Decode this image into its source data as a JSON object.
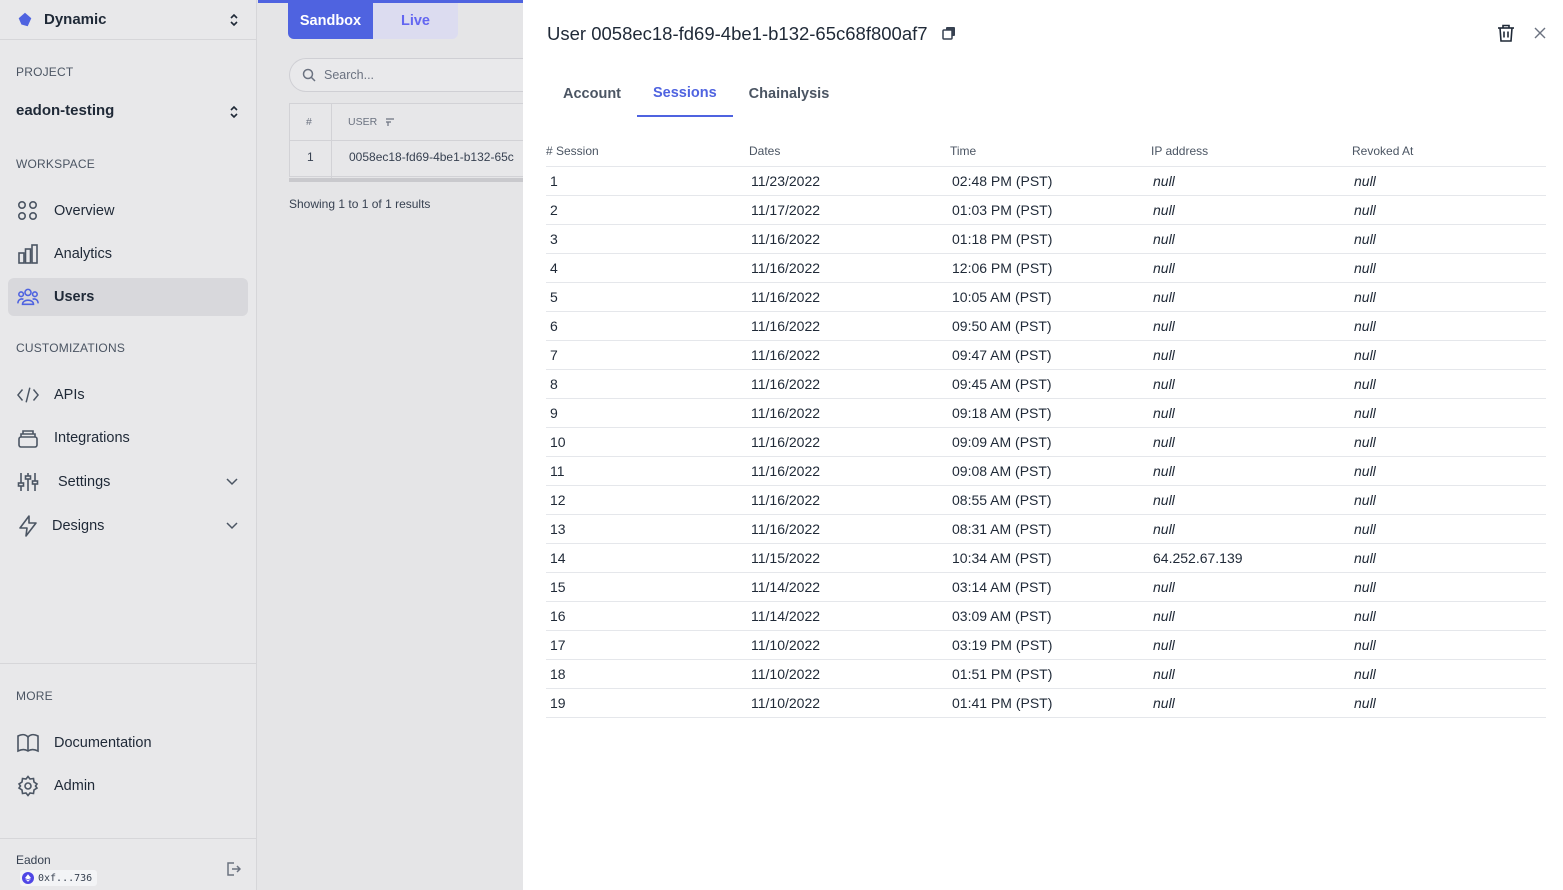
{
  "sidebar": {
    "org_name": "Dynamic",
    "project_label": "PROJECT",
    "project_name": "eadon-testing",
    "workspace_label": "WORKSPACE",
    "workspace_items": [
      {
        "label": "Overview",
        "icon": "grid-icon"
      },
      {
        "label": "Analytics",
        "icon": "bar-chart-icon"
      },
      {
        "label": "Users",
        "icon": "users-icon",
        "active": true
      }
    ],
    "customizations_label": "CUSTOMIZATIONS",
    "customization_items": [
      {
        "label": "APIs",
        "icon": "code-icon"
      },
      {
        "label": "Integrations",
        "icon": "layers-icon"
      },
      {
        "label": "Settings",
        "icon": "sliders-icon",
        "expandable": true
      },
      {
        "label": "Designs",
        "icon": "lightning-icon",
        "expandable": true
      }
    ],
    "more_label": "MORE",
    "more_items": [
      {
        "label": "Documentation",
        "icon": "book-icon"
      },
      {
        "label": "Admin",
        "icon": "gear-icon"
      }
    ],
    "footer": {
      "user_name": "Eadon",
      "wallet": "0xf...736"
    }
  },
  "main": {
    "env_tabs": [
      "Sandbox",
      "Live"
    ],
    "active_env": "Sandbox",
    "search_placeholder": "Search...",
    "table": {
      "headers": [
        "#",
        "USER"
      ],
      "rows": [
        [
          "1",
          "0058ec18-fd69-4be1-b132-65c"
        ]
      ]
    },
    "showing_text": "Showing 1 to 1 of 1 results"
  },
  "drawer": {
    "title": "User 0058ec18-fd69-4be1-b132-65c68f800af7",
    "tabs": [
      "Account",
      "Sessions",
      "Chainalysis"
    ],
    "active_tab": "Sessions",
    "columns": [
      "# Session",
      "Dates",
      "Time",
      "IP address",
      "Revoked At"
    ],
    "sessions": [
      [
        "1",
        "11/23/2022",
        "02:48 PM (PST)",
        "null",
        "null"
      ],
      [
        "2",
        "11/17/2022",
        "01:03 PM (PST)",
        "null",
        "null"
      ],
      [
        "3",
        "11/16/2022",
        "01:18 PM (PST)",
        "null",
        "null"
      ],
      [
        "4",
        "11/16/2022",
        "12:06 PM (PST)",
        "null",
        "null"
      ],
      [
        "5",
        "11/16/2022",
        "10:05 AM (PST)",
        "null",
        "null"
      ],
      [
        "6",
        "11/16/2022",
        "09:50 AM (PST)",
        "null",
        "null"
      ],
      [
        "7",
        "11/16/2022",
        "09:47 AM (PST)",
        "null",
        "null"
      ],
      [
        "8",
        "11/16/2022",
        "09:45 AM (PST)",
        "null",
        "null"
      ],
      [
        "9",
        "11/16/2022",
        "09:18 AM (PST)",
        "null",
        "null"
      ],
      [
        "10",
        "11/16/2022",
        "09:09 AM (PST)",
        "null",
        "null"
      ],
      [
        "11",
        "11/16/2022",
        "09:08 AM (PST)",
        "null",
        "null"
      ],
      [
        "12",
        "11/16/2022",
        "08:55 AM (PST)",
        "null",
        "null"
      ],
      [
        "13",
        "11/16/2022",
        "08:31 AM (PST)",
        "null",
        "null"
      ],
      [
        "14",
        "11/15/2022",
        "10:34 AM (PST)",
        "64.252.67.139",
        "null"
      ],
      [
        "15",
        "11/14/2022",
        "03:14 AM (PST)",
        "null",
        "null"
      ],
      [
        "16",
        "11/14/2022",
        "03:09 AM (PST)",
        "null",
        "null"
      ],
      [
        "17",
        "11/10/2022",
        "03:19 PM (PST)",
        "null",
        "null"
      ],
      [
        "18",
        "11/10/2022",
        "01:51 PM (PST)",
        "null",
        "null"
      ],
      [
        "19",
        "11/10/2022",
        "01:41 PM (PST)",
        "null",
        "null"
      ]
    ]
  },
  "colors": {
    "accent": "#4f63e0",
    "sidebar_bg": "#e8e8ea",
    "active_item_bg": "#d8d8dc"
  }
}
